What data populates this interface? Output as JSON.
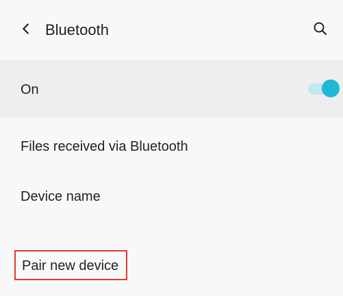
{
  "header": {
    "title": "Bluetooth",
    "back_icon": "chevron-left-icon",
    "search_icon": "search-icon"
  },
  "bluetooth_toggle": {
    "label": "On",
    "state": true,
    "accent": "#1fb8d7",
    "track_color": "#bfe8ef"
  },
  "settings": {
    "items": [
      {
        "label": "Files received via Bluetooth"
      },
      {
        "label": "Device name"
      }
    ]
  },
  "pair_new_device": {
    "label": "Pair new device",
    "highlight_color": "#e53935"
  },
  "theme": {
    "background": "#f8f8f8",
    "toggle_row_background": "#eeeeee",
    "text": "#222222"
  }
}
